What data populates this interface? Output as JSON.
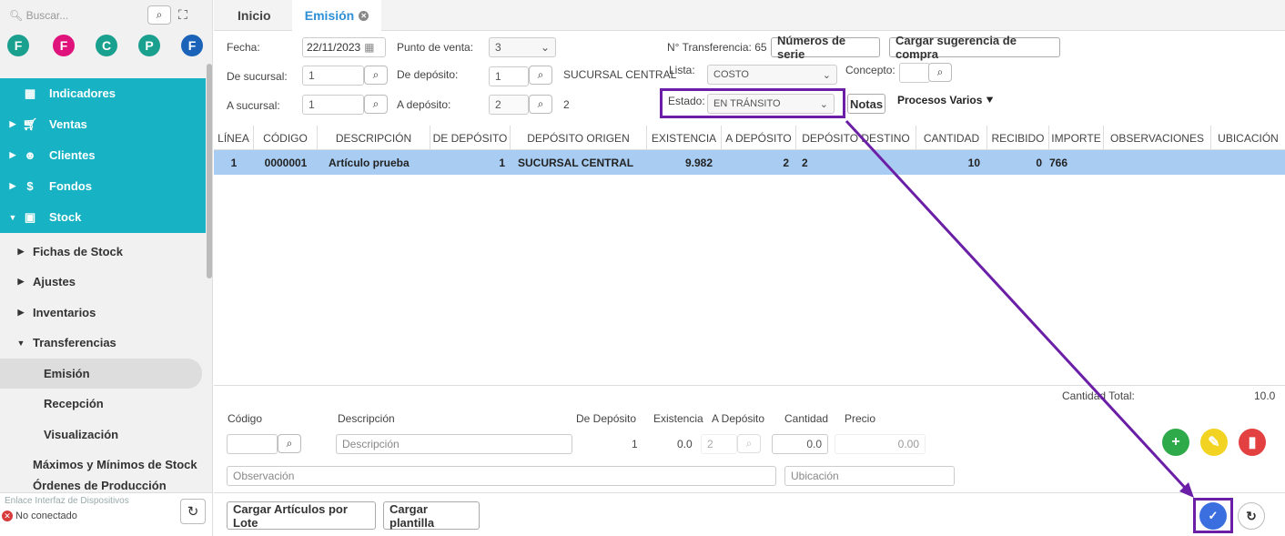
{
  "sidebar": {
    "search_placeholder": "Buscar...",
    "avatars": [
      {
        "letter": "F",
        "color": "#1aa08e"
      },
      {
        "letter": "F",
        "color": "#e0127c"
      },
      {
        "letter": "C",
        "color": "#1aa08e"
      },
      {
        "letter": "P",
        "color": "#1aa08e"
      },
      {
        "letter": "F",
        "color": "#1a63b8"
      }
    ],
    "menu": [
      "Indicadores",
      "Ventas",
      "Clientes",
      "Fondos",
      "Stock"
    ],
    "submenu": [
      "Fichas de Stock",
      "Ajustes",
      "Inventarios",
      "Transferencias",
      "Emisión",
      "Recepción",
      "Visualización",
      "Máximos y Mínimos de Stock",
      "Órdenes de Producción"
    ],
    "device_link": "Enlace Interfaz de Dispositivos",
    "device_status": "No conectado"
  },
  "tabs": {
    "inicio": "Inicio",
    "emision": "Emisión"
  },
  "form": {
    "fecha_label": "Fecha:",
    "fecha_value": "22/11/2023",
    "punto_label": "Punto de venta:",
    "punto_value": "3",
    "transf_label": "N° Transferencia:",
    "transf_value": "65",
    "numeros_serie": "Números de serie",
    "cargar_sugerencia": "Cargar sugerencia de compra",
    "de_sucursal_label": "De sucursal:",
    "de_sucursal_value": "1",
    "de_deposito_label": "De depósito:",
    "de_deposito_value": "1",
    "de_deposito_name": "SUCURSAL CENTRAL",
    "lista_label": "Lista:",
    "lista_value": "COSTO",
    "concepto_label": "Concepto:",
    "a_sucursal_label": "A sucursal:",
    "a_sucursal_value": "1",
    "a_deposito_label": "A depósito:",
    "a_deposito_value": "2",
    "a_deposito_name": "2",
    "estado_label": "Estado:",
    "estado_value": "EN TRÁNSITO",
    "notas": "Notas",
    "procesos": "Procesos Varios"
  },
  "grid": {
    "headers": [
      "LÍNEA",
      "CÓDIGO",
      "DESCRIPCIÓN",
      "DE DEPÓSITO",
      "DEPÓSITO ORIGEN",
      "EXISTENCIA",
      "A DEPÓSITO",
      "DEPÓSITO DESTINO",
      "CANTIDAD",
      "RECIBIDO",
      "IMPORTE",
      "OBSERVACIONES",
      "UBICACIÓN"
    ],
    "row": [
      "1",
      "0000001",
      "Artículo prueba",
      "1",
      "SUCURSAL CENTRAL",
      "9.982",
      "2",
      "2",
      "10",
      "0",
      "766"
    ]
  },
  "footer": {
    "cantidad_total_label": "Cantidad Total:",
    "cantidad_total_value": "10.0",
    "codigo_label": "Código",
    "descripcion_label": "Descripción",
    "de_deposito_label": "De Depósito",
    "existencia_label": "Existencia",
    "a_deposito_label": "A Depósito",
    "cantidad_label": "Cantidad",
    "precio_label": "Precio",
    "descripcion_ph": "Descripción",
    "de_deposito_value": "1",
    "existencia_value": "0.0",
    "a_deposito_value": "2",
    "cantidad_value": "0.0",
    "precio_value": "0.00",
    "observacion_ph": "Observación",
    "ubicacion_ph": "Ubicación",
    "cargar_lote": "Cargar Artículos por Lote",
    "cargar_plantilla": "Cargar plantilla"
  },
  "colors": {
    "accent": "#17b2c4",
    "tab_active": "#2e8fd6",
    "annotation": "#6a1fa6",
    "row_selected": "#a9cdf2"
  }
}
